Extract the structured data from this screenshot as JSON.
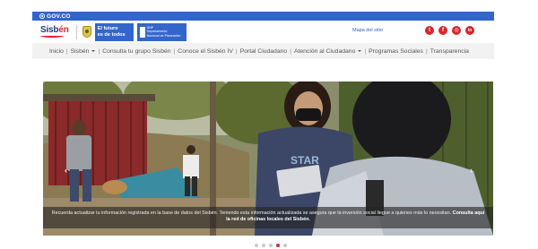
{
  "gov_bar": {
    "label": "GOV.CO"
  },
  "header": {
    "logo_text_a": "Sisb",
    "logo_text_b": "én",
    "futuro_line1": "El futuro",
    "futuro_line2": "es de todos",
    "dnp_line1": "DNP",
    "dnp_line2": "Departamento",
    "dnp_line3": "Nacional de Planeación",
    "mapa_sitio": "Mapa del sitio",
    "socials": [
      {
        "icon": "twitter-icon",
        "glyph": "t"
      },
      {
        "icon": "facebook-icon",
        "glyph": "f"
      },
      {
        "icon": "instagram-icon",
        "glyph": "◎"
      },
      {
        "icon": "linkedin-icon",
        "glyph": "in"
      }
    ]
  },
  "nav": {
    "items": [
      {
        "label": "Inicio",
        "dropdown": false
      },
      {
        "label": "Sisbén",
        "dropdown": true
      },
      {
        "label": "Consulta tu grupo Sisbén",
        "dropdown": false
      },
      {
        "label": "Conoce el Sisbén IV",
        "dropdown": false
      },
      {
        "label": "Portal Ciudadano",
        "dropdown": false
      },
      {
        "label": "Atención al Ciudadano",
        "dropdown": true
      },
      {
        "label": "Programas Sociales",
        "dropdown": false
      },
      {
        "label": "Transparencia",
        "dropdown": false
      }
    ]
  },
  "carousel": {
    "caption_text": "Recuerda actualizar tu información registrada en la base de datos del Sisbén. Teniendo esta información actualizada se asegura que la inversión social llegue a quienes más lo necesitan.",
    "caption_link": "Consulta aquí la red de oficinas locales del Sisbén.",
    "prev_glyph": "‹",
    "next_glyph": "›",
    "shirt_text": "STAR",
    "indicators": 5,
    "active_index": 3
  },
  "colors": {
    "gov_blue": "#3366cc",
    "brand_red": "#e0242c",
    "brand_navy": "#1f3b77",
    "nav_bg": "#f2f2f2"
  }
}
